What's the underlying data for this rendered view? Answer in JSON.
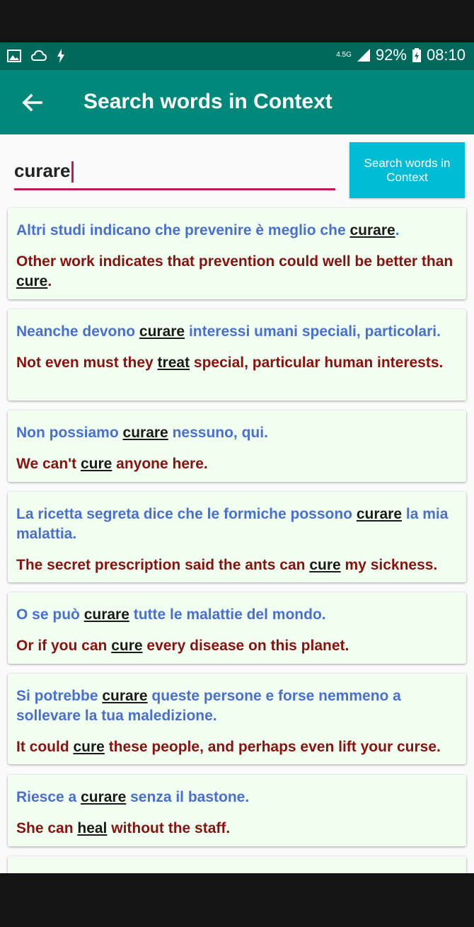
{
  "status_bar": {
    "network": "4.5G",
    "battery": "92%",
    "time": "08:10"
  },
  "app_bar": {
    "back_icon": "arrow-left-icon",
    "title": "Search words in Context"
  },
  "search": {
    "value": "curare",
    "button_label": "Search words in Context"
  },
  "results": [
    {
      "it": [
        "Altri studi indicano che prevenire è meglio che ",
        "curare",
        "."
      ],
      "en": [
        "Other work indicates that prevention could well be better than ",
        "cure",
        "."
      ]
    },
    {
      "it": [
        "Neanche devono ",
        "curare",
        " interessi umani speciali, particolari."
      ],
      "en": [
        "Not even must they ",
        "treat",
        " special, particular human interests."
      ]
    },
    {
      "it": [
        "Non possiamo ",
        "curare",
        " nessuno, qui."
      ],
      "en": [
        "We can't ",
        "cure",
        " anyone here."
      ]
    },
    {
      "it": [
        "La ricetta segreta dice che le formiche possono ",
        "curare",
        " la mia malattia."
      ],
      "en": [
        "The secret prescription said the ants can ",
        "cure",
        " my sickness."
      ]
    },
    {
      "it": [
        "O se può ",
        "curare",
        " tutte le malattie del mondo."
      ],
      "en": [
        "Or if you can ",
        "cure",
        " every disease on this planet."
      ]
    },
    {
      "it": [
        "Si potrebbe ",
        "curare",
        " queste persone e forse nemmeno a sollevare la tua maledizione."
      ],
      "en": [
        "It could ",
        "cure",
        " these people, and perhaps even lift your curse."
      ]
    },
    {
      "it": [
        "Riesce a ",
        "curare",
        " senza il bastone."
      ],
      "en": [
        "She can ",
        "heal",
        " without the staff."
      ]
    }
  ]
}
